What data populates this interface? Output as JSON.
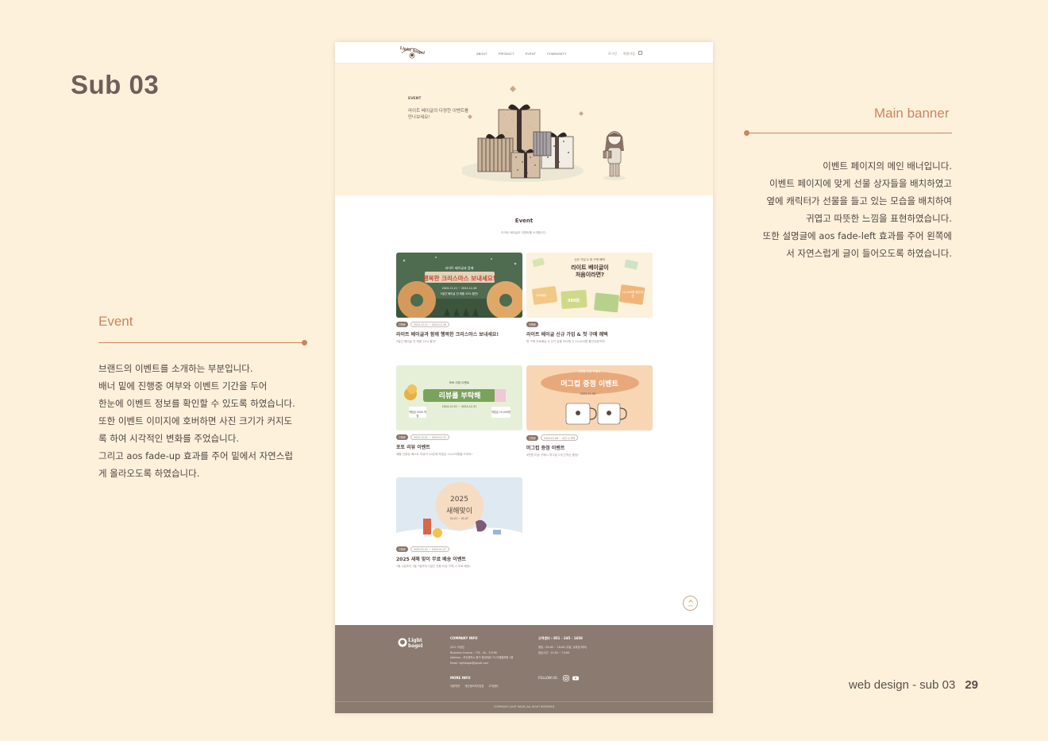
{
  "sub_title": "Sub 03",
  "main_banner": {
    "heading": "Main banner",
    "lines": [
      "이벤트 페이지의 메인 배너입니다.",
      "이벤트 페이지에 맞게 선물 상자들을 배치하였고",
      "옆에 캐릭터가 선물을 들고 있는 모습을 배치하여",
      "귀엽고 따뜻한 느낌을 표현하였습니다.",
      "또한 설명글에 aos fade-left 효과를 주어 왼쪽에",
      "서 자연스럽게 글이 들어오도록 하였습니다."
    ]
  },
  "event_note": {
    "heading": "Event",
    "lines": [
      "브랜드의 이벤트를 소개하는 부분입니다.",
      "배너 밑에 진행중 여부와 이벤트 기간을 두어",
      "한눈에 이벤트 정보를 확인할 수 있도록 하였습니다.",
      "또한 이벤트 이미지에 호버하면 사진 크기가 커지도",
      "록 하여 시각적인 변화를 주었습니다.",
      "그리고 aos fade-up 효과를 주어 밑에서 자연스럽",
      "게 올라오도록 하였습니다."
    ]
  },
  "page_footer": {
    "label": "web design - sub 03",
    "number": "29"
  },
  "mock": {
    "logo": "Light bagel",
    "nav": [
      "ABOUT",
      "PRODUCT",
      "EVENT",
      "COMMUNITY"
    ],
    "util": [
      "로그인",
      "회원가입"
    ],
    "banner": {
      "label": "EVENT",
      "desc": "라이트 베이글의 다양한 이벤트를 만나보세요!"
    },
    "event_title": "Event",
    "event_sub": "라이트 베이글의 이벤트를 소개합니다.",
    "cards": [
      {
        "status": "진행중",
        "dates": "2024.12.21 ~ 2024.12.26",
        "title": "라이트 베이글과 함께 행복한 크리스마스 보내세요!",
        "desc": "5일간 베이글 전 제품 25% 할인!",
        "img_heading": "라이트 베이글과 함께",
        "img_main": "행복한 크리스마스 보내세요!",
        "img_dates": "2024.12.21 ~ 2024.12.26",
        "img_sub": "5일간 베이글 전 제품 25% 할인!"
      },
      {
        "status": "진행중",
        "dates": "",
        "title": "라이트 베이글 신규 가입 & 첫 구매 혜택",
        "desc": "첫 구매 무료배송 & 인기 상품 990원 & 10,000원 할인쿠폰까지!",
        "img_heading": "신규 가입 & 첫 구매 혜택",
        "img_main": "라이트 베이글이 처음이라면?",
        "tickets": [
          "무료배송",
          "990원",
          "10,000원 할인쿠폰"
        ]
      },
      {
        "status": "진행중",
        "dates": "2024.12.01 ~ 2024.12.31",
        "title": "포토 리뷰 이벤트",
        "desc": "매월 선정된 베스트 리뷰어 10분께 적립금 10,000원을 드려요!",
        "img_heading": "포토 리뷰 이벤트",
        "img_main": "리뷰를 부탁해",
        "img_dates": "2024.12.01 ~ 2024.12.31",
        "chips": [
          "적립금 5000 적립",
          "적립금 10,000원"
        ]
      },
      {
        "status": "진행중",
        "dates": "2025.01.06 ~ 소진 시 까지",
        "title": "머그컵 증정 이벤트",
        "desc": "3만원 이상 구매시 머그컵 1개 선착순 증정!",
        "img_heading": "3만원 이상 구매시",
        "img_main": "머그컵 증정 이벤트",
        "img_dates": "2025.01.06 ~"
      },
      {
        "status": "진행중",
        "dates": "2025.01.01 ~ 2025.01.07",
        "title": "2025 새해 맞이 무료 배송 이벤트",
        "desc": "1월 1일부터 1월 7일까지 2일간 전원 이상 구매 시 무료 배송!",
        "img_heading": "2025",
        "img_main": "새해맞이",
        "img_dates": "01.01 ~ 01.07"
      }
    ],
    "top_label": "TOP",
    "footer": {
      "logo": "Light bagel",
      "company_head": "COMPANY INFO",
      "company_lines": [
        "CEO: 이영은",
        "Business License : 778 - 40 - 23198",
        "Address : 부산광역시 중구 중앙대로 74 디젠플랫폼 1층",
        "Email: lightbagel@gmail.com"
      ],
      "more_head": "MORE INFO",
      "more_links": [
        "이용약관",
        "개인정보처리방침",
        "고객센터"
      ],
      "cs_head": "고객센터 : 851 - 245 - 1658",
      "cs_lines": [
        "평일 : 09:00 ~ 18:00 (주말, 공휴일 제외)",
        "점심시간 : 12:00 ~ 13:00"
      ],
      "follow": "FOLLOW US",
      "copyright": "COPYRIGHT LIGHT BAGEL ALL RIGHT RESERVED"
    }
  },
  "colors": {
    "accent": "#c9865f",
    "bg": "#fdf1dc",
    "footer": "#8b7a70"
  }
}
